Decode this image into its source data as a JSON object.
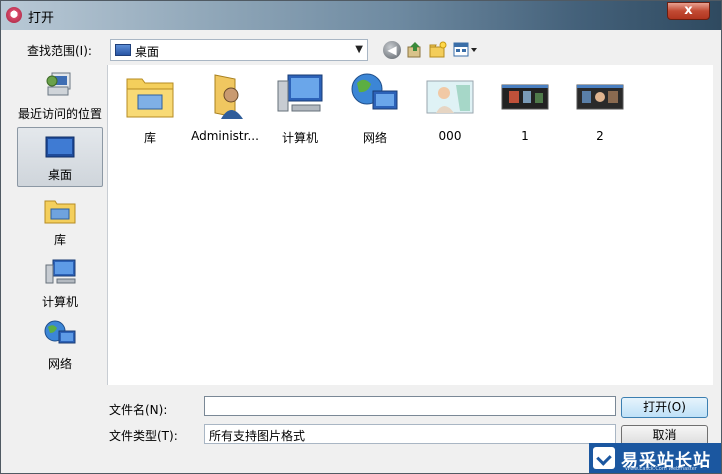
{
  "window": {
    "title": "打开",
    "close_symbol": "x"
  },
  "lookin": {
    "label": "查找范围(I):",
    "value": "桌面"
  },
  "toolbar": {
    "back": "◀"
  },
  "sidebar": {
    "items": [
      {
        "label": "最近访问的位置"
      },
      {
        "label": "桌面"
      },
      {
        "label": "库"
      },
      {
        "label": "计算机"
      },
      {
        "label": "网络"
      }
    ]
  },
  "files": [
    {
      "name": "库"
    },
    {
      "name": "Administr..."
    },
    {
      "name": "计算机"
    },
    {
      "name": "网络"
    },
    {
      "name": "000"
    },
    {
      "name": "1"
    },
    {
      "name": "2"
    }
  ],
  "filename": {
    "label": "文件名(N):",
    "value": ""
  },
  "filetype": {
    "label": "文件类型(T):",
    "value": "所有支持图片格式"
  },
  "buttons": {
    "open": "打开(O)",
    "cancel": "取消"
  },
  "watermark": {
    "text": "易采站长站",
    "sub": "Www.Easck.Com Webmaster"
  }
}
